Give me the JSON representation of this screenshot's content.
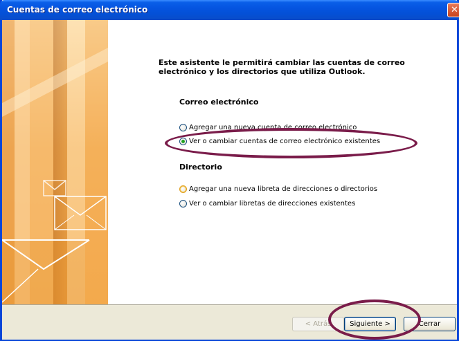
{
  "window": {
    "title": "Cuentas de correo electrónico",
    "close_symbol": "✕"
  },
  "intro": "Este asistente le permitirá cambiar las cuentas de correo electrónico y los directorios que utiliza Outlook.",
  "email_section": {
    "heading": "Correo electrónico",
    "options": [
      {
        "label": "Agregar una nueva cuenta de correo electrónico",
        "checked": false
      },
      {
        "label": "Ver o cambiar cuentas de correo electrónico existentes",
        "checked": true
      }
    ]
  },
  "directory_section": {
    "heading": "Directorio",
    "options": [
      {
        "label": "Agregar una nueva libreta de direcciones o directorios",
        "checked": false
      },
      {
        "label": "Ver o cambiar libretas de direcciones existentes",
        "checked": false
      }
    ]
  },
  "buttons": {
    "back": "< Atrás",
    "next": "Siguiente >",
    "close": "Cerrar"
  },
  "colors": {
    "titlebar": "#0554e0",
    "annotation": "#7a1c4a",
    "art_orange": "#f0a040"
  }
}
